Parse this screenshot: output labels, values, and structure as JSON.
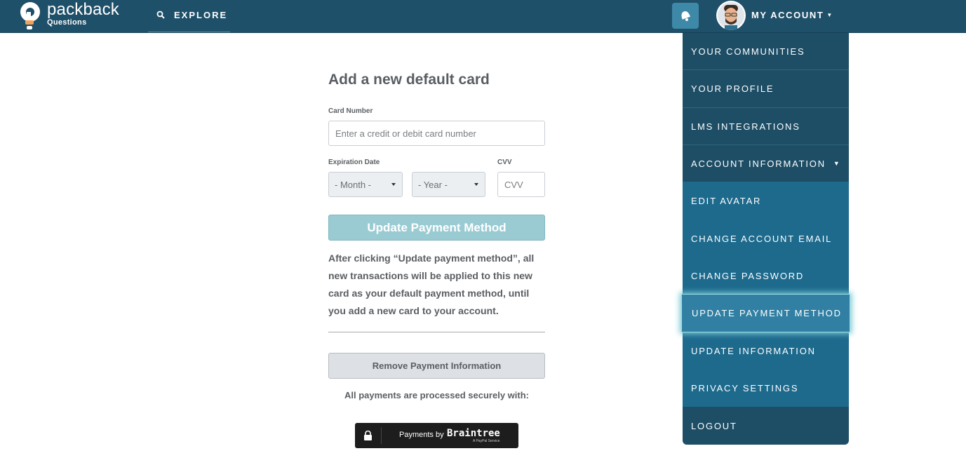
{
  "header": {
    "logo_word": "packback",
    "logo_sub": "Questions",
    "explore_label": "EXPLORE",
    "account_label": "MY ACCOUNT"
  },
  "form": {
    "title": "Add a new default card",
    "card_number_label": "Card Number",
    "card_number_placeholder": "Enter a credit or debit card number",
    "expiration_label": "Expiration Date",
    "month_value": "- Month -",
    "year_value": "- Year -",
    "cvv_label": "CVV",
    "cvv_placeholder": "CVV",
    "update_button": "Update Payment Method",
    "paragraph": "After clicking “Update payment method”, all new transactions will be applied to this new card as your default payment method, until you add a new card to your account.",
    "remove_button": "Remove Payment Information",
    "secure_text": "All payments are processed securely with:",
    "braintree_prefix": "Payments by",
    "braintree_name": "Braintree",
    "braintree_sub": "A PayPal Service"
  },
  "menu": {
    "items": [
      {
        "label": "YOUR COMMUNITIES"
      },
      {
        "label": "YOUR PROFILE"
      },
      {
        "label": "LMS INTEGRATIONS"
      },
      {
        "label": "ACCOUNT INFORMATION"
      },
      {
        "label": "EDIT AVATAR"
      },
      {
        "label": "CHANGE ACCOUNT EMAIL"
      },
      {
        "label": "CHANGE PASSWORD"
      },
      {
        "label": "UPDATE PAYMENT METHOD"
      },
      {
        "label": "UPDATE INFORMATION"
      },
      {
        "label": "PRIVACY SETTINGS"
      },
      {
        "label": "LOGOUT"
      }
    ]
  },
  "colors": {
    "header_bg": "#1f5069",
    "menu_dark": "#1e4e66",
    "menu_sub": "#1d6a8d",
    "menu_active": "#3180a3",
    "update_button": "#9acbd3"
  }
}
